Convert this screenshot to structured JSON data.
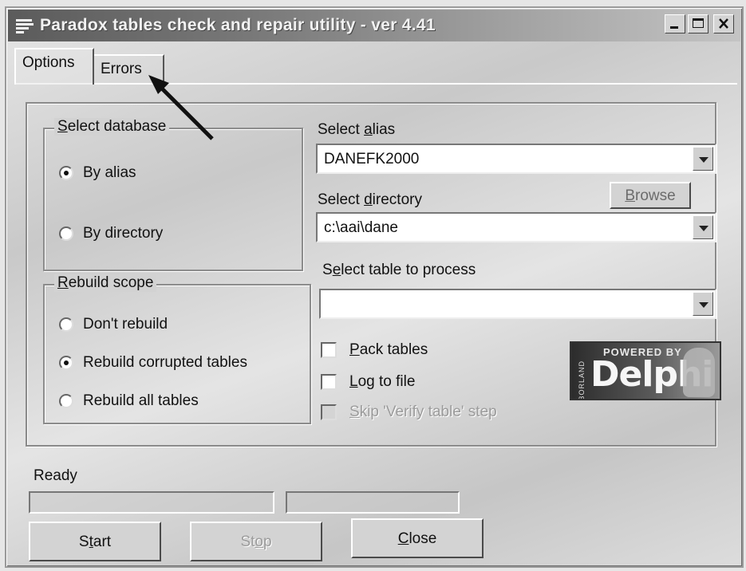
{
  "window": {
    "title": "Paradox tables check and repair utility - ver 4.41",
    "title_icon": "lines-app-icon",
    "controls": [
      "minimize-icon",
      "maximize-icon",
      "close-icon"
    ]
  },
  "tabs": [
    {
      "label": "Options",
      "active": true
    },
    {
      "label": "Errors",
      "active": false
    }
  ],
  "select_database": {
    "legend_accel": "S",
    "legend_rest": "elect database",
    "options": [
      {
        "label": "By alias",
        "selected": true
      },
      {
        "label": "By directory",
        "selected": false
      }
    ]
  },
  "rebuild_scope": {
    "legend_accel": "R",
    "legend_rest": "ebuild scope",
    "options": [
      {
        "label": "Don't rebuild",
        "selected": false
      },
      {
        "label": "Rebuild corrupted tables",
        "selected": true
      },
      {
        "label": "Rebuild all tables",
        "selected": false
      }
    ]
  },
  "alias": {
    "label_pre": "Select ",
    "label_accel": "a",
    "label_post": "lias",
    "value": "DANEFK2000"
  },
  "directory": {
    "label_pre": "Select ",
    "label_accel": "d",
    "label_post": "irectory",
    "value": "c:\\aai\\dane",
    "browse_accel": "B",
    "browse_rest": "rowse"
  },
  "table": {
    "label_pre": "S",
    "label_accel": "e",
    "label_post": "lect table to process",
    "value": ""
  },
  "checkboxes": [
    {
      "accel": "P",
      "rest": "ack tables",
      "checked": false,
      "enabled": true
    },
    {
      "accel": "L",
      "rest": "og to file",
      "checked": false,
      "enabled": true
    },
    {
      "accel": "S",
      "pre": "",
      "rest": "kip 'Verify table' step",
      "checked": false,
      "enabled": false
    }
  ],
  "logo": {
    "top": "POWERED BY",
    "side": "BORLAND",
    "main": "Delphi"
  },
  "status": {
    "text": "Ready"
  },
  "buttons": {
    "start_pre": "S",
    "start_accel": "t",
    "start_post": "art",
    "stop_pre": "St",
    "stop_accel": "o",
    "stop_post": "p",
    "close_accel": "C",
    "close_rest": "lose"
  },
  "annotation": {
    "arrow_color": "#111111"
  }
}
